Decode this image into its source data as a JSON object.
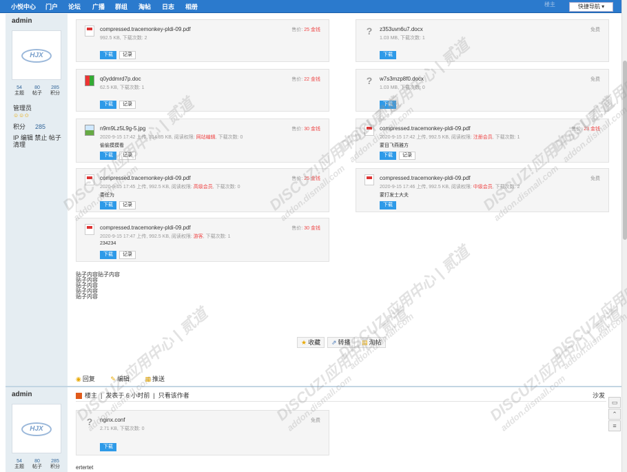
{
  "nav": {
    "items": [
      "小悦中心",
      "门户",
      "论坛",
      "广播",
      "群组",
      "淘帖",
      "日志",
      "相册"
    ],
    "quick_nav": "快捷导航 ▾",
    "faint": "楼主"
  },
  "user": {
    "name": "admin",
    "avatar_text": "HJX",
    "stats": [
      {
        "num": "54",
        "label": "主题"
      },
      {
        "num": "80",
        "label": "帖子"
      },
      {
        "num": "285",
        "label": "积分"
      }
    ],
    "role": "管理员",
    "stars": "☺☺✩",
    "score_label": "积分",
    "score_value": "285",
    "tools": "IP 编辑 禁止 帖子 清理"
  },
  "attachments": [
    {
      "name": "compressed.tracemonkey-pldi-09.pdf",
      "meta": "992.5 KB, 下载次数: 2",
      "meta_red": "",
      "meta_tail": "",
      "desc": "",
      "price_label": "售价: ",
      "price": "25 金钱",
      "download": "下载",
      "record": "记录",
      "icon": "pdf-icon"
    },
    {
      "name": "z353uvn6u7.docx",
      "meta": "1.03 MB, 下载次数: 1",
      "meta_red": "",
      "meta_tail": "",
      "desc": "",
      "price_label": "免费",
      "price": "",
      "download": "下载",
      "record": "",
      "icon": "question-icon"
    },
    {
      "name": "q0yddmrd7p.doc",
      "meta": "62.5 KB, 下载次数: 1",
      "meta_red": "",
      "meta_tail": "",
      "desc": "",
      "price_label": "售价: ",
      "price": "22 金钱",
      "download": "下载",
      "record": "记录",
      "icon": "doc-icon"
    },
    {
      "name": "w7s3mzp8f0.docx",
      "meta": "1.03 MB, 下载次数: 0",
      "meta_red": "",
      "meta_tail": "",
      "desc": "",
      "price_label": "免费",
      "price": "",
      "download": "下载",
      "record": "",
      "icon": "question-icon"
    },
    {
      "name": "n9m9Lz5L9g-5.jpg",
      "meta": "2020-9-15 17:42 上传, 314.85 KB, 阅读权限: ",
      "meta_red": "网站编辑",
      "meta_tail": ", 下载次数: 0",
      "desc": "偷偷摸摸看",
      "price_label": "售价: ",
      "price": "30 金钱",
      "download": "下载",
      "record": "记录",
      "icon": "image-icon"
    },
    {
      "name": "compressed.tracemonkey-pldi-09.pdf",
      "meta": "2020-9-15 17:42 上传, 992.5 KB, 阅读权限: ",
      "meta_red": "注册会员",
      "meta_tail": ", 下载次数: 1",
      "desc": "蒙目飞燕雅方",
      "price_label": "售价: ",
      "price": "23 金钱",
      "download": "下载",
      "record": "记录",
      "icon": "pdf-icon"
    },
    {
      "name": "compressed.tracemonkey-pldi-09.pdf",
      "meta": "2020-9-15 17:45 上传, 992.5 KB, 阅读权限: ",
      "meta_red": "高级会员",
      "meta_tail": ", 下载次数: 0",
      "desc": "委任为",
      "price_label": "售价: ",
      "price": "25 金钱",
      "download": "下载",
      "record": "记录",
      "icon": "pdf-icon"
    },
    {
      "name": "compressed.tracemonkey-pldi-09.pdf",
      "meta": "2020-9-15 17:46 上传, 992.5 KB, 阅读权限: ",
      "meta_red": "中级会员",
      "meta_tail": ", 下载次数: 2",
      "desc": "蒙打发士大夫",
      "price_label": "免费",
      "price": "",
      "download": "下载",
      "record": "",
      "icon": "pdf-icon"
    },
    {
      "name": "compressed.tracemonkey-pldi-09.pdf",
      "meta": "2020-9-15 17:47 上传, 992.5 KB, 阅读权限: ",
      "meta_red": "游客",
      "meta_tail": ", 下载次数: 1",
      "desc": "234234",
      "price_label": "售价: ",
      "price": "30 金钱",
      "download": "下载",
      "record": "记录",
      "icon": "pdf-icon"
    }
  ],
  "post_text": [
    "贴子内容贴子内容",
    "贴子内容",
    "贴子内容",
    "贴子内容",
    "贴子内容"
  ],
  "actions": {
    "favorite": "收藏",
    "forward": "转播",
    "quote": "淘帖"
  },
  "bottom_actions": {
    "reply": "回复",
    "edit": "编辑",
    "recommend": "推送"
  },
  "post2": {
    "author_label": "楼主",
    "posted": "发表于 6 小时前",
    "only_author": "只看该作者",
    "floor": "沙发",
    "attachment": {
      "name": "nginx.conf",
      "meta": "2.71 KB, 下载次数: 0",
      "price_label": "免费",
      "download": "下载"
    },
    "text": "ertertet"
  },
  "watermark": {
    "main": "DISCUZ!应用中心 | 贰道",
    "sub": "addon.dismall.com"
  }
}
